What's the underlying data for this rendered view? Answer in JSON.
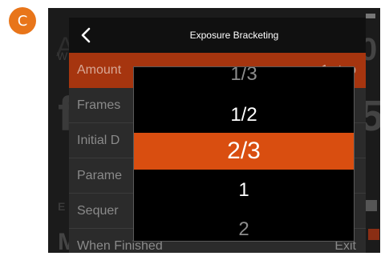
{
  "callout": {
    "letter": "C"
  },
  "header": {
    "title": "Exposure Bracketing",
    "back_icon": "chevron-left-icon"
  },
  "menu": {
    "items": [
      {
        "label": "Amount",
        "value": "1 stop"
      },
      {
        "label": "Frames",
        "value": ""
      },
      {
        "label": "Initial D",
        "value": ""
      },
      {
        "label": "Parame",
        "value": ""
      },
      {
        "label": "Sequer",
        "value": ""
      },
      {
        "label": "When Finished",
        "value": "Exit"
      }
    ],
    "selected_index": 0
  },
  "picker": {
    "options": [
      "1/3",
      "1/2",
      "2/3",
      "1",
      "2"
    ],
    "selected": "2/3"
  },
  "background": {
    "left_top": "A",
    "left_sub": "W",
    "left_big": "f",
    "left_e": "E",
    "left_bottom": "M",
    "right_top": "0",
    "right_big": "5"
  },
  "colors": {
    "accent": "#d94e10",
    "row_highlight": "#a6350f",
    "callout": "#e8751a"
  }
}
